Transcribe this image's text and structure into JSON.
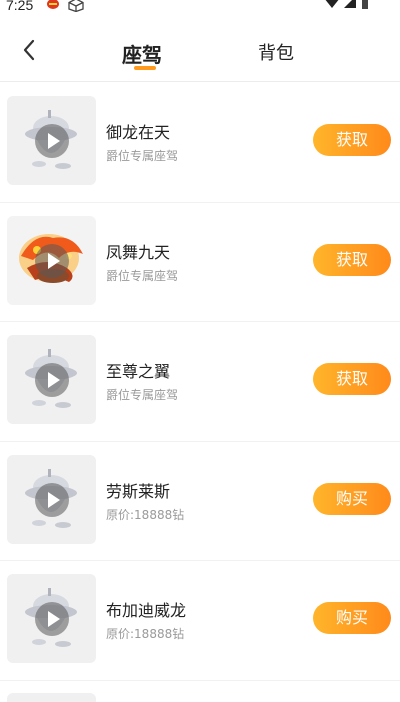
{
  "status_bar": {
    "time": "7:25"
  },
  "header": {
    "tabs": [
      {
        "label": "座驾",
        "active": true
      },
      {
        "label": "背包",
        "active": false
      }
    ]
  },
  "colors": {
    "accent": "#ff9a1e",
    "button_start": "#ffb52b",
    "button_end": "#ff8a1a",
    "subtext": "#9a9a9a"
  },
  "items": [
    {
      "name": "御龙在天",
      "subtitle": "爵位专属座驾",
      "action": "获取",
      "thumb": "silver-ufo"
    },
    {
      "name": "凤舞九天",
      "subtitle": "爵位专属座驾",
      "action": "获取",
      "thumb": "fire-phoenix"
    },
    {
      "name": "至尊之翼",
      "subtitle": "爵位专属座驾",
      "action": "获取",
      "thumb": "silver-ufo"
    },
    {
      "name": "劳斯莱斯",
      "subtitle": "原价:18888钻",
      "action": "购买",
      "thumb": "silver-ufo"
    },
    {
      "name": "布加迪威龙",
      "subtitle": "原价:18888钻",
      "action": "购买",
      "thumb": "silver-ufo"
    }
  ]
}
